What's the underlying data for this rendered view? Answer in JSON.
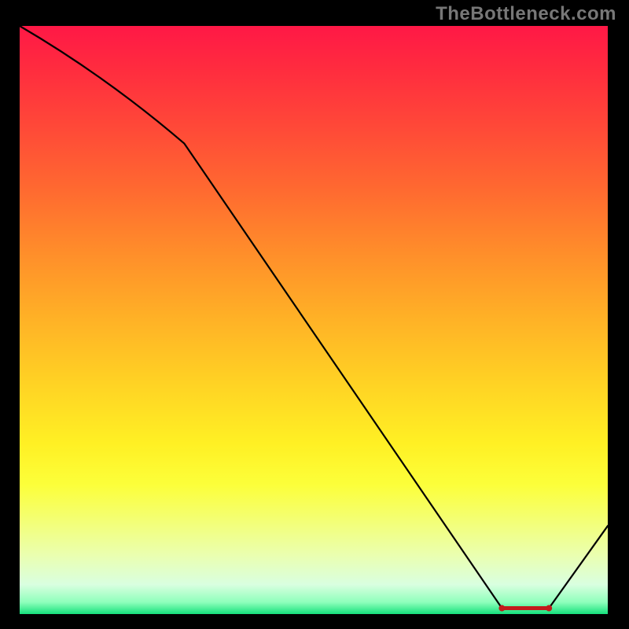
{
  "attribution": "TheBottleneck.com",
  "chart_data": {
    "type": "line",
    "title": "",
    "xlabel": "",
    "ylabel": "",
    "xlim": [
      0,
      100
    ],
    "ylim": [
      0,
      100
    ],
    "x": [
      0,
      28,
      82,
      90,
      100
    ],
    "values": [
      100,
      80,
      1,
      1,
      15
    ],
    "optimal_range": {
      "x_start": 82,
      "x_end": 90,
      "y": 1
    },
    "gradient_stops": [
      {
        "pos": 0,
        "color": "#ff1846"
      },
      {
        "pos": 50,
        "color": "#ffb226"
      },
      {
        "pos": 78,
        "color": "#fcff3a"
      },
      {
        "pos": 100,
        "color": "#15e07c"
      }
    ]
  },
  "colors": {
    "background": "#000000",
    "curve": "#000000",
    "marker": "#c31a1a",
    "attribution_text": "#777777"
  }
}
